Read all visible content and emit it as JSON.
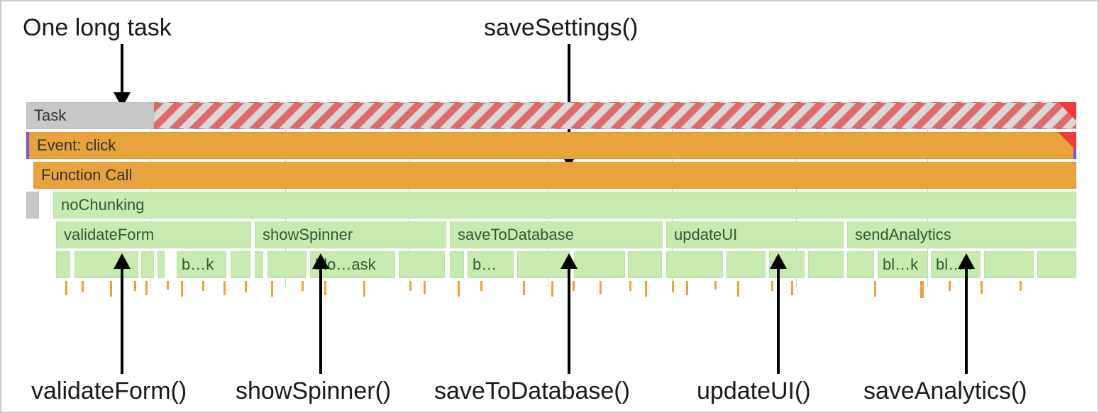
{
  "annotations": {
    "top_left": "One long task",
    "top_right": "saveSettings()",
    "bottom": {
      "validateForm": "validateForm()",
      "showSpinner": "showSpinner()",
      "saveToDatabase": "saveToDatabase()",
      "updateUI": "updateUI()",
      "saveAnalytics": "saveAnalytics()"
    }
  },
  "flame": {
    "task_label": "Task",
    "event_label": "Event: click",
    "funccall_label": "Function Call",
    "nochunking_label": "noChunking",
    "children": {
      "validateForm": "validateForm",
      "showSpinner": "showSpinner",
      "saveToDatabase": "saveToDatabase",
      "updateUI": "updateUI",
      "sendAnalytics": "sendAnalytics"
    },
    "blocks": {
      "b1": "b…k",
      "b2": "blo…ask",
      "b3": "b…",
      "b4": "bl…k",
      "b5": "bl…k"
    }
  },
  "colors": {
    "task_grey": "#c7c7c7",
    "task_red_stripe": "#e06a6a",
    "event_orange": "#e8a33d",
    "event_purple_border": "#7c57d6",
    "green": "#c7eab0",
    "red_triangle": "#ee3b3b"
  }
}
